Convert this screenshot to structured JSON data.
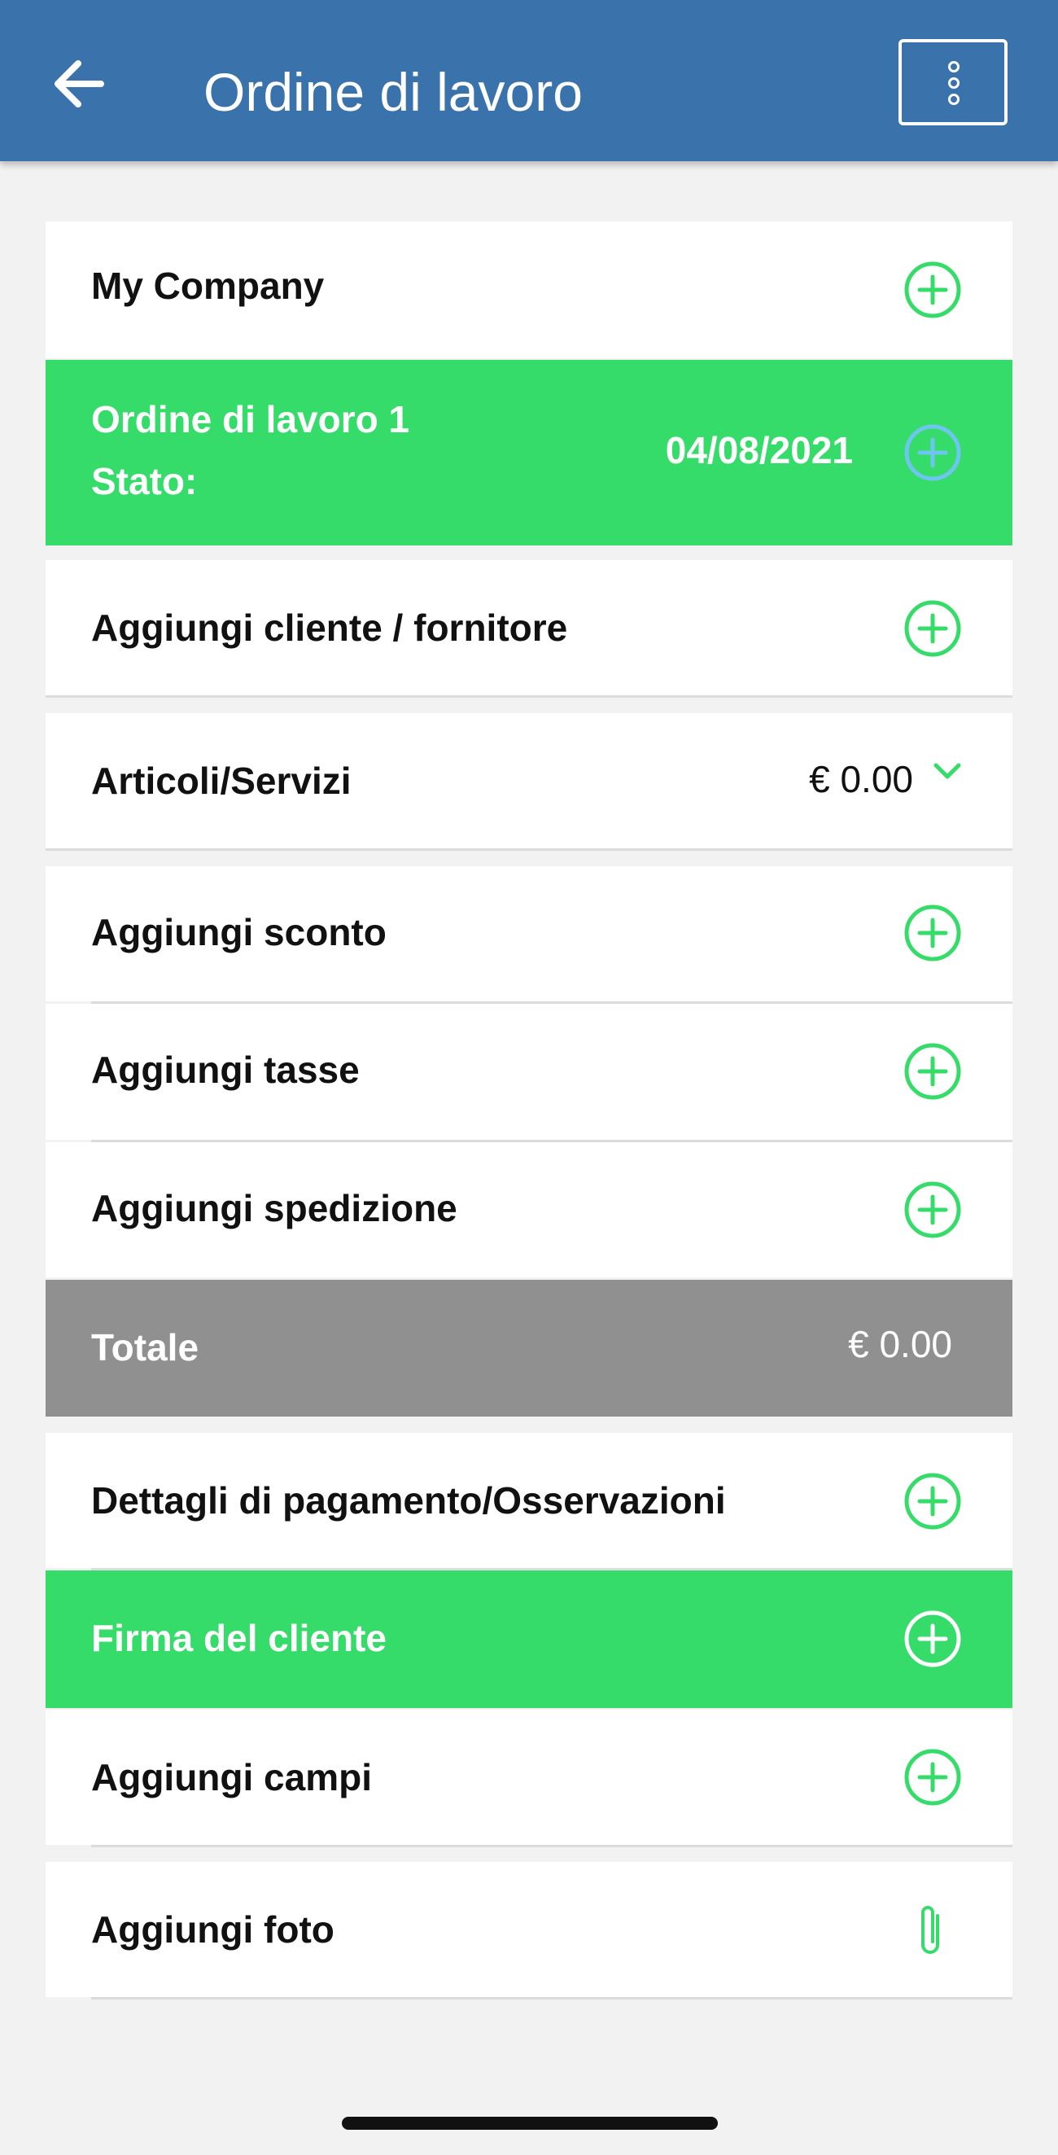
{
  "header": {
    "title": "Ordine di lavoro"
  },
  "company": {
    "name": "My Company"
  },
  "order": {
    "title": "Ordine di lavoro 1",
    "status_label": "Stato:",
    "date": "04/08/2021"
  },
  "rows": {
    "add_client": "Aggiungi cliente / fornitore",
    "items_label": "Articoli/Servizi",
    "items_amount": "€ 0.00",
    "add_discount": "Aggiungi sconto",
    "add_tax": "Aggiungi tasse",
    "add_shipping": "Aggiungi spedizione",
    "total_label": "Totale",
    "total_amount": "€ 0.00",
    "payment_details": "Dettagli di pagamento/Osservazioni",
    "signature": "Firma del cliente",
    "add_fields": "Aggiungi campi",
    "add_photo": "Aggiungi foto"
  },
  "colors": {
    "header_bg": "#3a72ab",
    "accent_green": "#36dc6a",
    "total_gray": "#909090",
    "plus_blue": "#6ec6f0"
  },
  "icons": [
    "back-arrow-icon",
    "more-vertical-icon",
    "plus-circle-icon",
    "chevron-down-icon",
    "paperclip-icon"
  ]
}
